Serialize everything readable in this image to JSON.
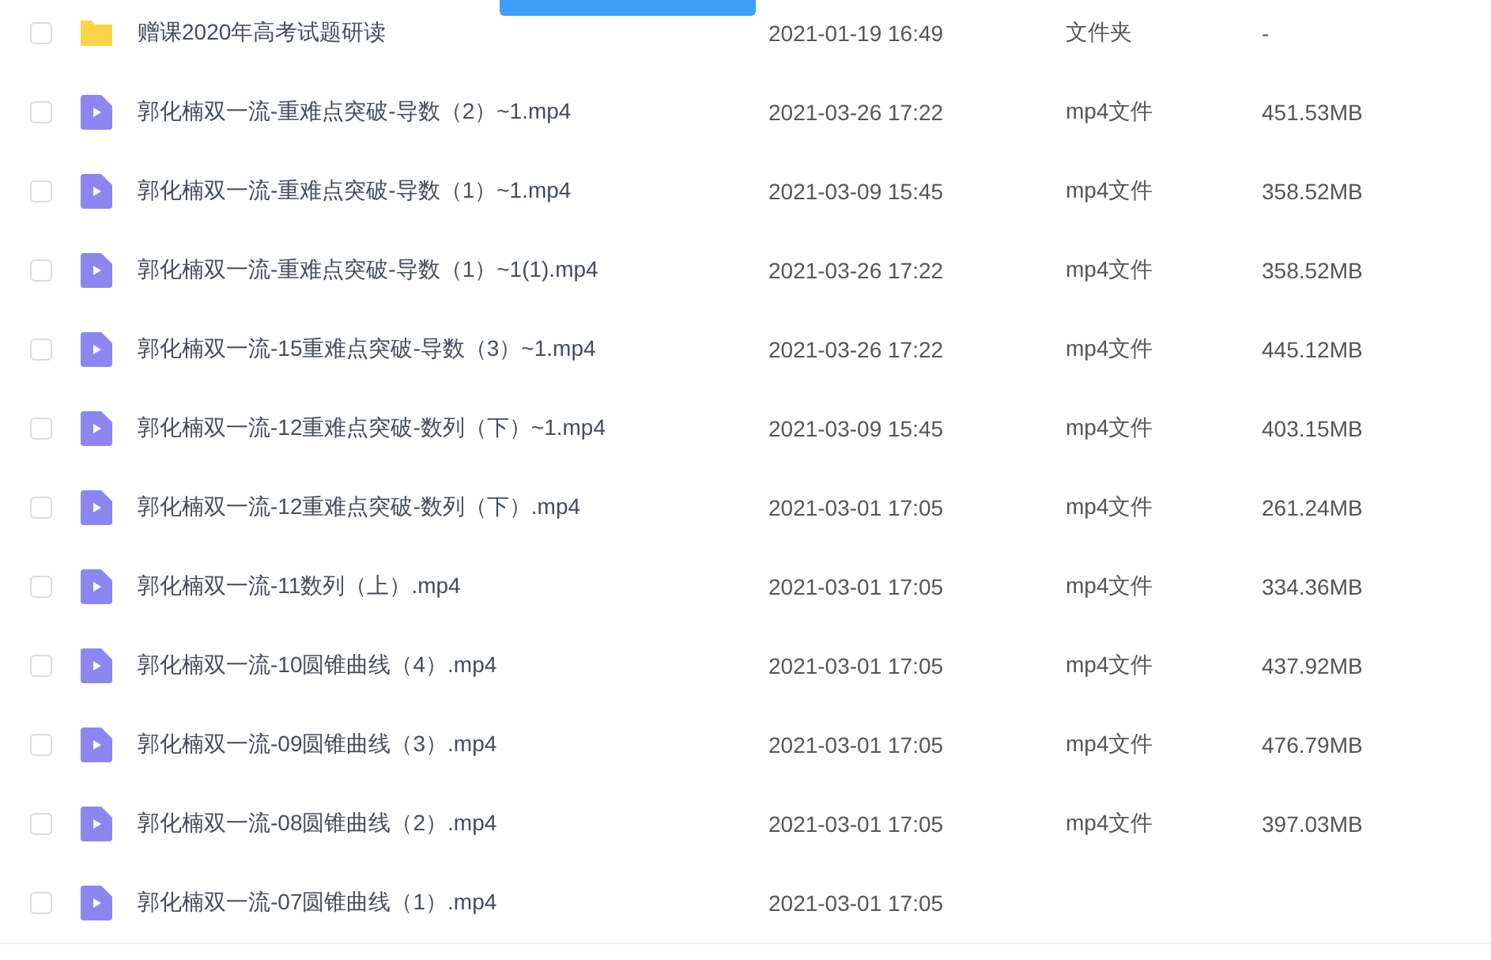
{
  "files": [
    {
      "kind": "folder",
      "name": "赠课2020年高考试题研读",
      "modified": "2021-01-19 16:49",
      "type": "文件夹",
      "size": "-",
      "checked": false
    },
    {
      "kind": "video",
      "name": "郭化楠双一流-重难点突破-导数（2）~1.mp4",
      "modified": "2021-03-26 17:22",
      "type": "mp4文件",
      "size": "451.53MB",
      "checked": false
    },
    {
      "kind": "video",
      "name": "郭化楠双一流-重难点突破-导数（1）~1.mp4",
      "modified": "2021-03-09 15:45",
      "type": "mp4文件",
      "size": "358.52MB",
      "checked": false
    },
    {
      "kind": "video",
      "name": "郭化楠双一流-重难点突破-导数（1）~1(1).mp4",
      "modified": "2021-03-26 17:22",
      "type": "mp4文件",
      "size": "358.52MB",
      "checked": false
    },
    {
      "kind": "video",
      "name": "郭化楠双一流-15重难点突破-导数（3）~1.mp4",
      "modified": "2021-03-26 17:22",
      "type": "mp4文件",
      "size": "445.12MB",
      "checked": false
    },
    {
      "kind": "video",
      "name": "郭化楠双一流-12重难点突破-数列（下）~1.mp4",
      "modified": "2021-03-09 15:45",
      "type": "mp4文件",
      "size": "403.15MB",
      "checked": false
    },
    {
      "kind": "video",
      "name": "郭化楠双一流-12重难点突破-数列（下）.mp4",
      "modified": "2021-03-01 17:05",
      "type": "mp4文件",
      "size": "261.24MB",
      "checked": false
    },
    {
      "kind": "video",
      "name": "郭化楠双一流-11数列（上）.mp4",
      "modified": "2021-03-01 17:05",
      "type": "mp4文件",
      "size": "334.36MB",
      "checked": false
    },
    {
      "kind": "video",
      "name": "郭化楠双一流-10圆锥曲线（4）.mp4",
      "modified": "2021-03-01 17:05",
      "type": "mp4文件",
      "size": "437.92MB",
      "checked": false
    },
    {
      "kind": "video",
      "name": "郭化楠双一流-09圆锥曲线（3）.mp4",
      "modified": "2021-03-01 17:05",
      "type": "mp4文件",
      "size": "476.79MB",
      "checked": false
    },
    {
      "kind": "video",
      "name": "郭化楠双一流-08圆锥曲线（2）.mp4",
      "modified": "2021-03-01 17:05",
      "type": "mp4文件",
      "size": "397.03MB",
      "checked": false
    },
    {
      "kind": "video",
      "name": "郭化楠双一流-07圆锥曲线（1）.mp4",
      "modified": "2021-03-01 17:05",
      "checked": false
    }
  ]
}
